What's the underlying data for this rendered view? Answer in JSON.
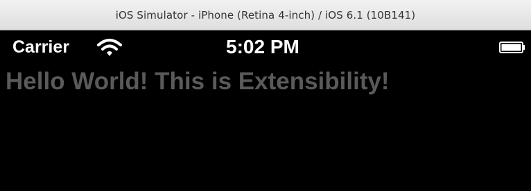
{
  "window": {
    "title": "iOS Simulator - iPhone (Retina 4-inch) / iOS 6.1 (10B141)"
  },
  "statusbar": {
    "carrier": "Carrier",
    "time": "5:02 PM",
    "wifi_icon": "wifi-icon",
    "battery_icon": "battery-icon",
    "battery_level": 1.0
  },
  "content": {
    "label": "Hello World! This is Extensibility!",
    "label_color": "#5a5a5a"
  },
  "colors": {
    "screen_background": "#000000",
    "status_text": "#ffffff"
  }
}
